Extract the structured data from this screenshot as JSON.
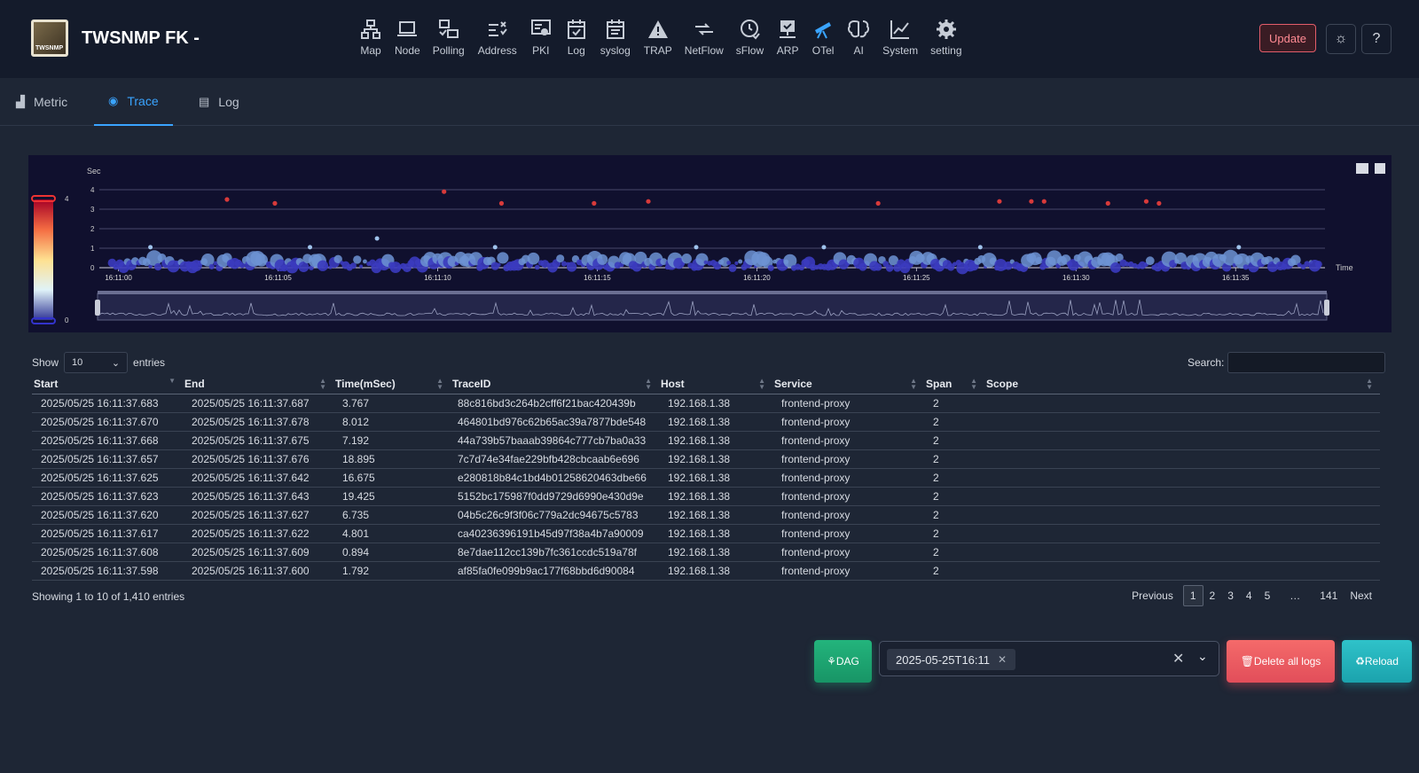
{
  "app": {
    "title": "TWSNMP FK -",
    "logo_text": "TWSNMP"
  },
  "nav": [
    {
      "label": "Map",
      "icon": "map-icon"
    },
    {
      "label": "Node",
      "icon": "laptop-icon"
    },
    {
      "label": "Polling",
      "icon": "polling-icon"
    },
    {
      "label": "Address",
      "icon": "address-icon"
    },
    {
      "label": "PKI",
      "icon": "certificate-icon"
    },
    {
      "label": "Log",
      "icon": "calendar-check-icon"
    },
    {
      "label": "syslog",
      "icon": "calendar-list-icon"
    },
    {
      "label": "TRAP",
      "icon": "warning-icon"
    },
    {
      "label": "NetFlow",
      "icon": "arrows-icon"
    },
    {
      "label": "sFlow",
      "icon": "clock-icon"
    },
    {
      "label": "ARP",
      "icon": "network-icon"
    },
    {
      "label": "OTel",
      "icon": "telescope-icon"
    },
    {
      "label": "AI",
      "icon": "brain-icon"
    },
    {
      "label": "System",
      "icon": "chart-line-icon"
    },
    {
      "label": "setting",
      "icon": "gear-icon"
    }
  ],
  "header_buttons": {
    "update": "Update",
    "theme": "☼",
    "help": "?"
  },
  "tabs": [
    {
      "label": "Metric",
      "icon": "bar-chart-icon",
      "active": false
    },
    {
      "label": "Trace",
      "icon": "eye-icon",
      "active": true
    },
    {
      "label": "Log",
      "icon": "list-icon",
      "active": false
    }
  ],
  "chart_data": {
    "type": "scatter",
    "ylabel": "Sec",
    "xlabel": "Time",
    "ylim": [
      0,
      4
    ],
    "yticks": [
      "0",
      "1",
      "2",
      "3",
      "4"
    ],
    "xticks": [
      "16:11:00",
      "16:11:05",
      "16:11:10",
      "16:11:15",
      "16:11:20",
      "16:11:25",
      "16:11:30",
      "16:11:35"
    ],
    "visualmap": {
      "min": "0",
      "max": "4"
    },
    "x_range_sec": [
      -0.6,
      37.8
    ],
    "outliers": [
      {
        "t": 3.4,
        "v": 3.5
      },
      {
        "t": 4.9,
        "v": 3.3
      },
      {
        "t": 10.2,
        "v": 3.9
      },
      {
        "t": 12.0,
        "v": 3.3
      },
      {
        "t": 14.9,
        "v": 3.3
      },
      {
        "t": 16.6,
        "v": 3.4
      },
      {
        "t": 23.8,
        "v": 3.3
      },
      {
        "t": 27.6,
        "v": 3.4
      },
      {
        "t": 28.6,
        "v": 3.4
      },
      {
        "t": 29.0,
        "v": 3.4
      },
      {
        "t": 31.0,
        "v": 3.3
      },
      {
        "t": 32.2,
        "v": 3.4
      },
      {
        "t": 32.6,
        "v": 3.3
      }
    ],
    "mid": [
      {
        "t": 8.1,
        "v": 1.5
      },
      {
        "t": 1.0,
        "v": 1.05
      },
      {
        "t": 6.0,
        "v": 1.05
      },
      {
        "t": 11.8,
        "v": 1.05
      },
      {
        "t": 18.1,
        "v": 1.05
      },
      {
        "t": 22.1,
        "v": 1.05
      },
      {
        "t": 27.0,
        "v": 1.05
      },
      {
        "t": 35.1,
        "v": 1.05
      }
    ]
  },
  "table": {
    "show_label": "Show",
    "entries_label": "entries",
    "length_value": "10",
    "search_label": "Search:",
    "columns": [
      "Start",
      "End",
      "Time(mSec)",
      "TraceID",
      "Host",
      "Service",
      "Span",
      "Scope"
    ],
    "rows": [
      [
        "2025/05/25 16:11:37.683",
        "2025/05/25 16:11:37.687",
        "3.767",
        "88c816bd3c264b2cff6f21bac420439b",
        "192.168.1.38",
        "frontend-proxy",
        "2",
        ""
      ],
      [
        "2025/05/25 16:11:37.670",
        "2025/05/25 16:11:37.678",
        "8.012",
        "464801bd976c62b65ac39a7877bde548",
        "192.168.1.38",
        "frontend-proxy",
        "2",
        ""
      ],
      [
        "2025/05/25 16:11:37.668",
        "2025/05/25 16:11:37.675",
        "7.192",
        "44a739b57baaab39864c777cb7ba0a33",
        "192.168.1.38",
        "frontend-proxy",
        "2",
        ""
      ],
      [
        "2025/05/25 16:11:37.657",
        "2025/05/25 16:11:37.676",
        "18.895",
        "7c7d74e34fae229bfb428cbcaab6e696",
        "192.168.1.38",
        "frontend-proxy",
        "2",
        ""
      ],
      [
        "2025/05/25 16:11:37.625",
        "2025/05/25 16:11:37.642",
        "16.675",
        "e280818b84c1bd4b01258620463dbe66",
        "192.168.1.38",
        "frontend-proxy",
        "2",
        ""
      ],
      [
        "2025/05/25 16:11:37.623",
        "2025/05/25 16:11:37.643",
        "19.425",
        "5152bc175987f0dd9729d6990e430d9e",
        "192.168.1.38",
        "frontend-proxy",
        "2",
        ""
      ],
      [
        "2025/05/25 16:11:37.620",
        "2025/05/25 16:11:37.627",
        "6.735",
        "04b5c26c9f3f06c779a2dc94675c5783",
        "192.168.1.38",
        "frontend-proxy",
        "2",
        ""
      ],
      [
        "2025/05/25 16:11:37.617",
        "2025/05/25 16:11:37.622",
        "4.801",
        "ca40236396191b45d97f38a4b7a90009",
        "192.168.1.38",
        "frontend-proxy",
        "2",
        ""
      ],
      [
        "2025/05/25 16:11:37.608",
        "2025/05/25 16:11:37.609",
        "0.894",
        "8e7dae112cc139b7fc361ccdc519a78f",
        "192.168.1.38",
        "frontend-proxy",
        "2",
        ""
      ],
      [
        "2025/05/25 16:11:37.598",
        "2025/05/25 16:11:37.600",
        "1.792",
        "af85fa0fe099b9ac177f68bbd6d90084",
        "192.168.1.38",
        "frontend-proxy",
        "2",
        ""
      ]
    ],
    "info": "Showing 1 to 10 of 1,410 entries",
    "pager": [
      "Previous",
      "1",
      "2",
      "3",
      "4",
      "5",
      "…",
      "141",
      "Next"
    ]
  },
  "footer": {
    "dag_label": "DAG",
    "filter_chip": "2025-05-25T16:11",
    "delete_label": "Delete all logs",
    "reload_label": "Reload"
  },
  "colors": {
    "accent": "#3aa4ff",
    "outlier": "#d83a3a",
    "point_low": "#3f3fc0",
    "point_mid": "#6b9ad6"
  }
}
